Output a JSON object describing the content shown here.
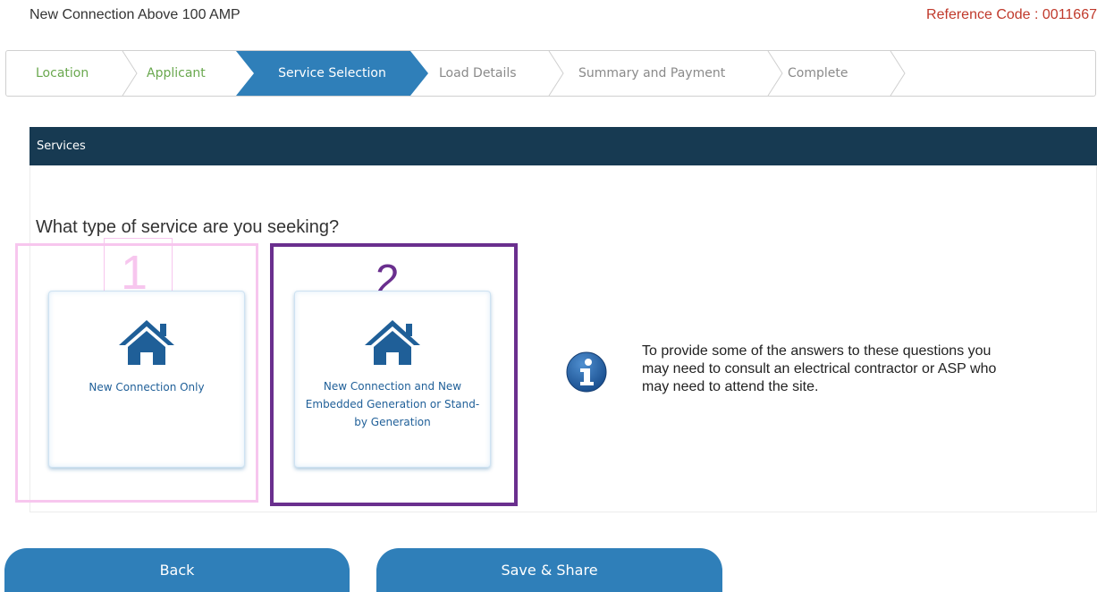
{
  "page": {
    "title": "New Connection Above 100 AMP",
    "reference_code": "Reference Code : 0011667"
  },
  "stepper": {
    "steps": [
      {
        "label": "Location",
        "state": "done"
      },
      {
        "label": "Applicant",
        "state": "done"
      },
      {
        "label": "Service Selection",
        "state": "active"
      },
      {
        "label": "Load Details",
        "state": "todo"
      },
      {
        "label": "Summary and Payment",
        "state": "todo"
      },
      {
        "label": "Complete",
        "state": "todo"
      }
    ],
    "colors": {
      "done": "#6aa84f",
      "active": "#2f7fb9",
      "todo": "#8a8a8a"
    }
  },
  "panel": {
    "header": "Services",
    "question": "What type of service are you seeking?"
  },
  "annotations": {
    "box1_number": "1",
    "box2_number": "2"
  },
  "options": [
    {
      "label": "New Connection Only",
      "icon": "house-icon"
    },
    {
      "label": "New Connection and New Embedded Generation or Stand-by Generation",
      "icon": "house-icon"
    }
  ],
  "info": {
    "icon": "info-icon",
    "text": "To provide some of the answers to these questions you\nmay need to consult an electrical contractor or ASP who\nmay need to attend the site."
  },
  "buttons": {
    "back": "Back",
    "save_share": "Save & Share"
  },
  "colors": {
    "header_bg": "#173a52",
    "primary": "#2f7fb9",
    "reference_code": "#c0392b",
    "card_text": "#1f5f98",
    "annotation_1": "#f7c6ee",
    "annotation_2": "#6a2f8e"
  }
}
